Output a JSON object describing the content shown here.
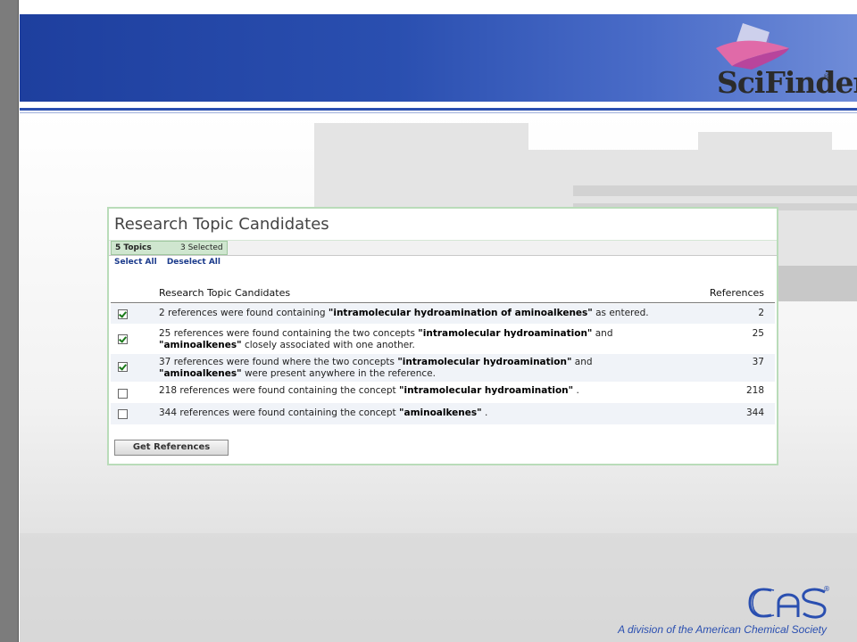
{
  "logo": {
    "brand": "SciFinder",
    "registered": "®"
  },
  "panel": {
    "title": "Research Topic Candidates",
    "topics_count": "5 Topics",
    "topics_selected": "3 Selected",
    "select_all": "Select All",
    "deselect_all": "Deselect All",
    "columns": {
      "topic": "Research Topic Candidates",
      "references": "References"
    },
    "rows": [
      {
        "checked": true,
        "pre": "2 references were found containing ",
        "b1": "\"intramolecular hydroamination of aminoalkenes\"",
        "mid": " as entered.",
        "b2": "",
        "post": "",
        "refs": "2"
      },
      {
        "checked": true,
        "pre": "25 references were found containing the two concepts ",
        "b1": "\"intramolecular hydroamination\"",
        "mid": " and ",
        "b2": "\"aminoalkenes\"",
        "post": " closely associated with one another.",
        "refs": "25"
      },
      {
        "checked": true,
        "pre": "37 references were found where the two concepts ",
        "b1": "\"intramolecular hydroamination\"",
        "mid": " and ",
        "b2": "\"aminoalkenes\"",
        "post": " were present anywhere in the reference.",
        "refs": "37"
      },
      {
        "checked": false,
        "pre": "218 references were found containing the concept ",
        "b1": "\"intramolecular hydroamination\"",
        "mid": " .",
        "b2": "",
        "post": "",
        "refs": "218"
      },
      {
        "checked": false,
        "pre": "344 references were found containing the concept ",
        "b1": "\"aminoalkenes\"",
        "mid": " .",
        "b2": "",
        "post": "",
        "refs": "344"
      }
    ],
    "button": "Get References"
  },
  "footer": {
    "cas_logo": "cas",
    "cas_registered": "®",
    "text": "A division of the American Chemical Society"
  }
}
